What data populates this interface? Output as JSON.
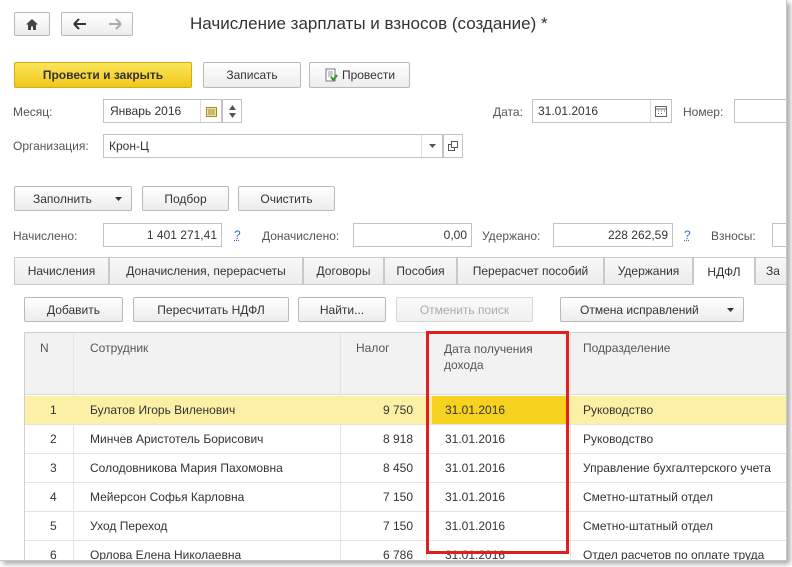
{
  "header": {
    "title": "Начисление зарплаты и взносов (создание) *",
    "home_icon": "home-icon",
    "back_icon": "arrow-left-icon",
    "forward_icon": "arrow-right-icon"
  },
  "toolbar": {
    "post_close": "Провести и закрыть",
    "save": "Записать",
    "post": "Провести"
  },
  "form": {
    "month_label": "Месяц:",
    "month_value": "Январь 2016",
    "date_label": "Дата:",
    "date_value": "31.01.2016",
    "number_label": "Номер:",
    "number_value": "",
    "org_label": "Организация:",
    "org_value": "Крон-Ц"
  },
  "actions": {
    "fill": "Заполнить",
    "select": "Подбор",
    "clear": "Очистить"
  },
  "totals": {
    "accrued_label": "Начислено:",
    "accrued_value": "1 401 271,41",
    "accrued_link": "?",
    "extra_label": "Доначислено:",
    "extra_value": "0,00",
    "withheld_label": "Удержано:",
    "withheld_value": "228 262,59",
    "withheld_link": "?",
    "contrib_label": "Взносы:"
  },
  "tabs": [
    "Начисления",
    "Доначисления, перерасчеты",
    "Договоры",
    "Пособия",
    "Перерасчет пособий",
    "Удержания",
    "НДФЛ",
    "За"
  ],
  "table_toolbar": {
    "add": "Добавить",
    "recalc": "Пересчитать НДФЛ",
    "find": "Найти...",
    "cancel_search": "Отменить поиск",
    "cancel_corrections": "Отмена исправлений"
  },
  "table": {
    "headers": {
      "n": "N",
      "employee": "Сотрудник",
      "tax": "Налог",
      "date": "Дата получения дохода",
      "department": "Подразделение"
    },
    "rows": [
      {
        "n": "1",
        "employee": "Булатов Игорь Виленович",
        "tax": "9 750",
        "date": "31.01.2016",
        "department": "Руководство"
      },
      {
        "n": "2",
        "employee": "Минчев Аристотель Борисович",
        "tax": "8 918",
        "date": "31.01.2016",
        "department": "Руководство"
      },
      {
        "n": "3",
        "employee": "Солодовникова Мария Пахомовна",
        "tax": "8 450",
        "date": "31.01.2016",
        "department": "Управление бухгалтерского учета"
      },
      {
        "n": "4",
        "employee": "Мейерсон Софья Карловна",
        "tax": "7 150",
        "date": "31.01.2016",
        "department": "Сметно-штатный отдел"
      },
      {
        "n": "5",
        "employee": "Уход Переход",
        "tax": "7 150",
        "date": "31.01.2016",
        "department": "Сметно-штатный отдел"
      },
      {
        "n": "6",
        "employee": "Орлова Елена Николаевна",
        "tax": "6 786",
        "date": "31.01.2016",
        "department": "Отдел расчетов по оплате труда"
      }
    ]
  },
  "colors": {
    "accent_yellow": "#f5d11f",
    "highlight_red": "#e02020",
    "selected_row": "#fbf0a6",
    "link": "#3a6fc5"
  }
}
